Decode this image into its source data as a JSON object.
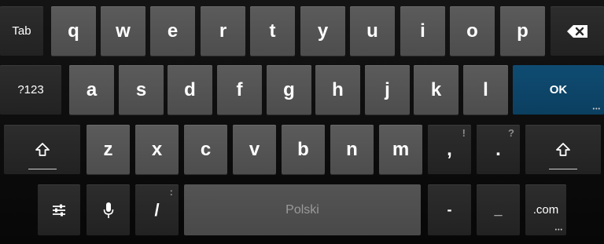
{
  "keyboard": {
    "row1": {
      "tab": "Tab",
      "letters": [
        "q",
        "w",
        "e",
        "r",
        "t",
        "y",
        "u",
        "i",
        "o",
        "p"
      ],
      "backspace_icon": "backspace-icon"
    },
    "row2": {
      "symbols": "?123",
      "letters": [
        "a",
        "s",
        "d",
        "f",
        "g",
        "h",
        "j",
        "k",
        "l"
      ],
      "ok": "OK"
    },
    "row3": {
      "shift_icon": "shift-icon",
      "letters": [
        "z",
        "x",
        "c",
        "v",
        "b",
        "n",
        "m"
      ],
      "comma": ",",
      "comma_hint": "!",
      "period": ".",
      "period_hint": "?"
    },
    "row4": {
      "settings_icon": "settings-sliders-icon",
      "mic_icon": "microphone-icon",
      "slash": "/",
      "slash_hint": ":",
      "space": "Polski",
      "dash": "-",
      "underscore": "_",
      "dotcom": ".com"
    },
    "colors": {
      "letter_key": "#555555",
      "function_key": "#262626",
      "ok_key": "#0d4568",
      "background": "#0b0b0b"
    }
  }
}
